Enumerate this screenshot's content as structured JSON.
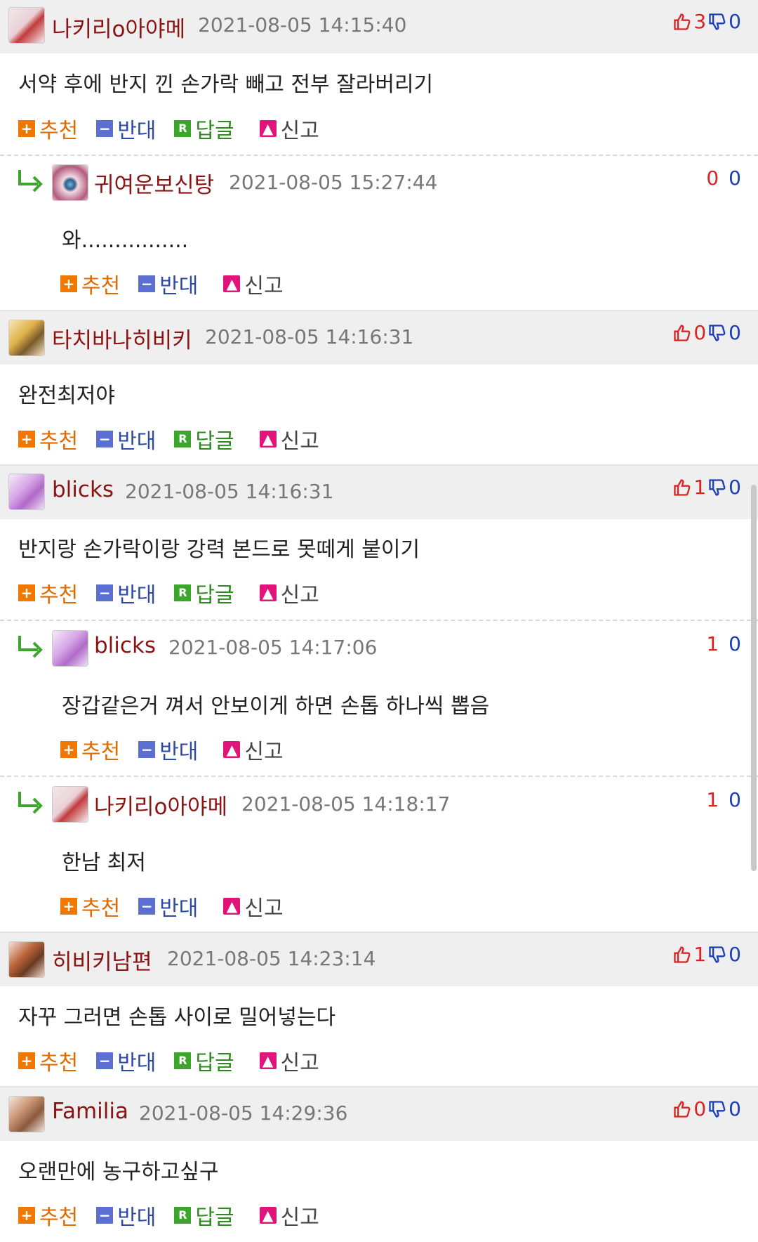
{
  "actions": {
    "recommend": "추천",
    "oppose": "반대",
    "reply": "답글",
    "report": "신고",
    "reply_icon": "R"
  },
  "colors": {
    "nickname": "#8a1414",
    "upvote": "#dd2222",
    "downvote": "#1a3fb8",
    "recommend": "#e06b00",
    "oppose": "#2d49a8",
    "reply": "#2a8a1e"
  },
  "comments": [
    {
      "nick": "나키리o아야메",
      "date": "2021-08-05 14:15:40",
      "up": "3",
      "down": "0",
      "text": "서약 후에 반지 낀 손가락 빼고 전부 잘라버리기"
    },
    {
      "nick": "귀여운보신탕",
      "date": "2021-08-05 15:27:44",
      "up": "0",
      "down": "0",
      "text": "와................"
    },
    {
      "nick": "타치바나히비키",
      "date": "2021-08-05 14:16:31",
      "up": "0",
      "down": "0",
      "text": "완전최저야"
    },
    {
      "nick": "blicks",
      "date": "2021-08-05 14:16:31",
      "up": "1",
      "down": "0",
      "text": "반지랑 손가락이랑 강력 본드로 못떼게 붙이기"
    },
    {
      "nick": "blicks",
      "date": "2021-08-05 14:17:06",
      "up": "1",
      "down": "0",
      "text": "장갑같은거 껴서 안보이게 하면 손톱 하나씩 뽑음"
    },
    {
      "nick": "나키리o아야메",
      "date": "2021-08-05 14:18:17",
      "up": "1",
      "down": "0",
      "text": "한남 최저"
    },
    {
      "nick": "히비키남편",
      "date": "2021-08-05 14:23:14",
      "up": "1",
      "down": "0",
      "text": "자꾸 그러면 손톱 사이로 밀어넣는다"
    },
    {
      "nick": "Familia",
      "date": "2021-08-05 14:29:36",
      "up": "0",
      "down": "0",
      "text": "오랜만에 농구하고싶구"
    }
  ]
}
